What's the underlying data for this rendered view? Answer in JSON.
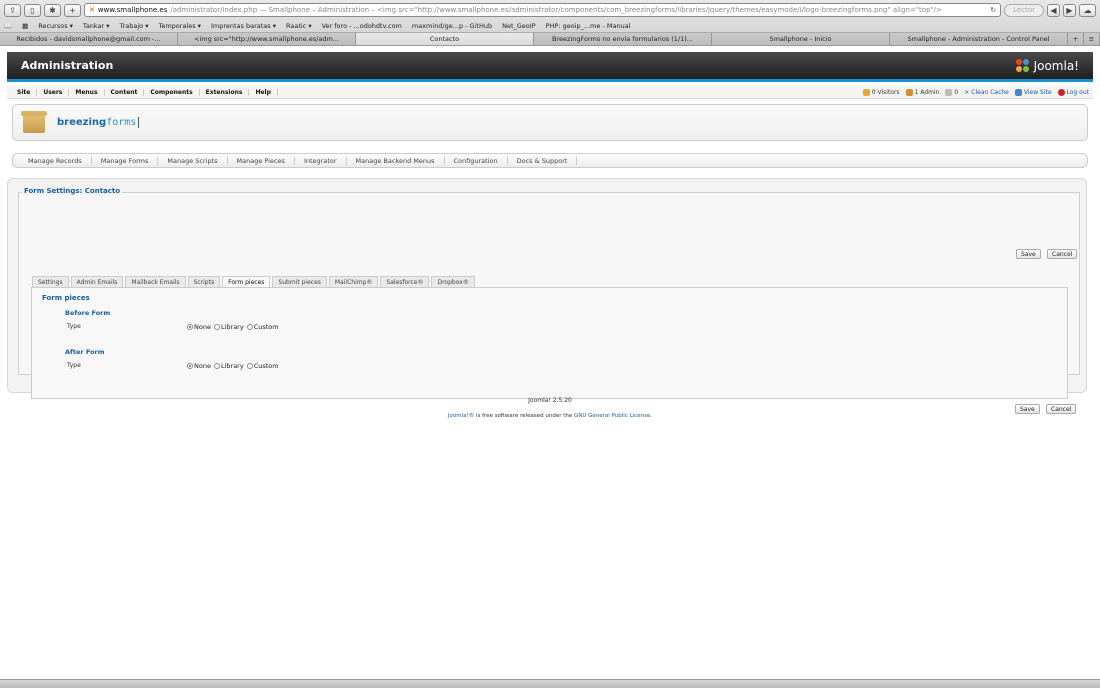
{
  "browser": {
    "url_host": "www.smallphone.es",
    "url_rest": "/administrator/index.php — Smallphone – Administration – <img src=\"http://www.smallphone.es/administrator/components/com_breezingforms/libraries/jquery/themes/easymode/i/logo-breezingforms.png\" align=\"top\"/>",
    "reader": "Lector",
    "bookmarks": [
      "Recursos ▾",
      "Tankar ▾",
      "Trabajo ▾",
      "Temporales ▾",
      "Imprentas baratas ▾",
      "Raatic ▾",
      "Ver foro - ...odohdtv.com",
      "maxmind/ge...p - GitHub",
      "Net_GeoIP",
      "PHP: geoip_...me - Manual"
    ],
    "tabs": [
      "Recibidos - davidsmallphone@gmail.com -...",
      "<img src=\"http://www.smallphone.es/adm...",
      "Contacto",
      "BreezingForms no envía formularios (1/1)...",
      "Smallphone - Inicio",
      "Smallphone - Administration - Control Panel"
    ]
  },
  "header": {
    "title": "Administration",
    "logo_text": "Joomla!"
  },
  "menu": {
    "items": [
      "Site",
      "Users",
      "Menus",
      "Content",
      "Components",
      "Extensions",
      "Help"
    ],
    "status": {
      "visitors": "0 Visitors",
      "admins": "1 Admin",
      "messages": "0",
      "clean_cache": "Clean Cache",
      "view_site": "View Site",
      "logout": "Log out"
    }
  },
  "component": {
    "logo_part1": "breezing",
    "logo_part2": "forms"
  },
  "submenu": [
    "Manage Records",
    "Manage Forms",
    "Manage Scripts",
    "Manage Pieces",
    "Integrator",
    "Manage Backend Menus",
    "Configuration",
    "Docs & Support"
  ],
  "form": {
    "legend": "Form Settings: Contacto",
    "save": "Save",
    "cancel": "Cancel",
    "tabs": [
      "Settings",
      "Admin Emails",
      "Mailback Emails",
      "Scripts",
      "Form pieces",
      "Submit pieces",
      "MailChimp®",
      "Salesforce®",
      "Dropbox®"
    ],
    "active_tab": "Form pieces",
    "section_title": "Form pieces",
    "before_title": "Before Form",
    "after_title": "After Form",
    "type_label": "Type",
    "options": [
      "None",
      "Library",
      "Custom"
    ]
  },
  "footer": {
    "version": "Joomla! 2.5.20",
    "license_prefix": "Joomla!®",
    "license_middle": " is free software released under the ",
    "license_link": "GNU General Public License."
  }
}
